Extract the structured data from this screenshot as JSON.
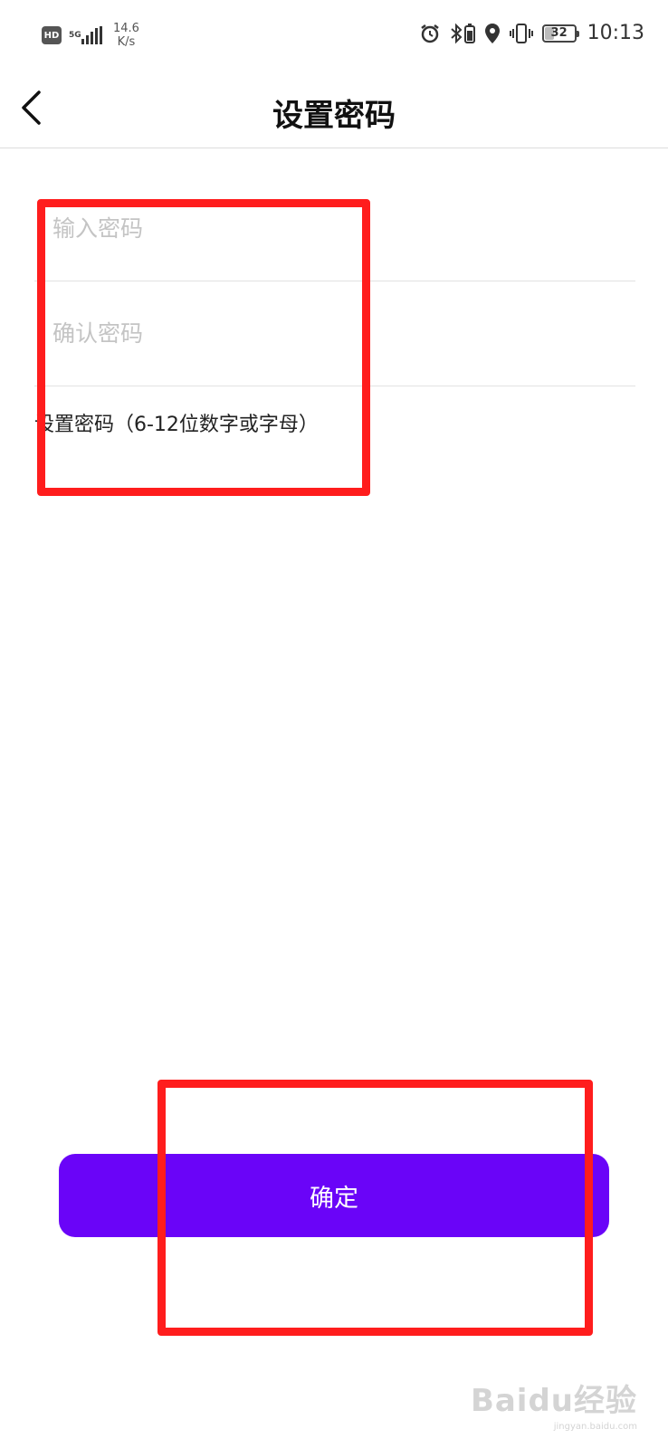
{
  "status_bar": {
    "hd": "HD",
    "network_type": "5G",
    "speed_value": "14.6",
    "speed_unit": "K/s",
    "battery_level": "32",
    "time": "10:13",
    "icons": [
      "alarm-icon",
      "bluetooth-icon",
      "location-icon",
      "vibrate-icon",
      "battery-icon"
    ]
  },
  "header": {
    "title": "设置密码",
    "back_icon": "chevron-left-icon"
  },
  "form": {
    "password_placeholder": "输入密码",
    "confirm_placeholder": "确认密码",
    "hint": "设置密码（6-12位数字或字母）"
  },
  "actions": {
    "confirm_label": "确定"
  },
  "colors": {
    "primary": "#6a04f8",
    "annotation": "#ff1d1d",
    "placeholder": "#c4c4c4",
    "divider": "#e2e2e2"
  },
  "watermark": {
    "logo": "Baidu经验",
    "url": "jingyan.baidu.com"
  }
}
